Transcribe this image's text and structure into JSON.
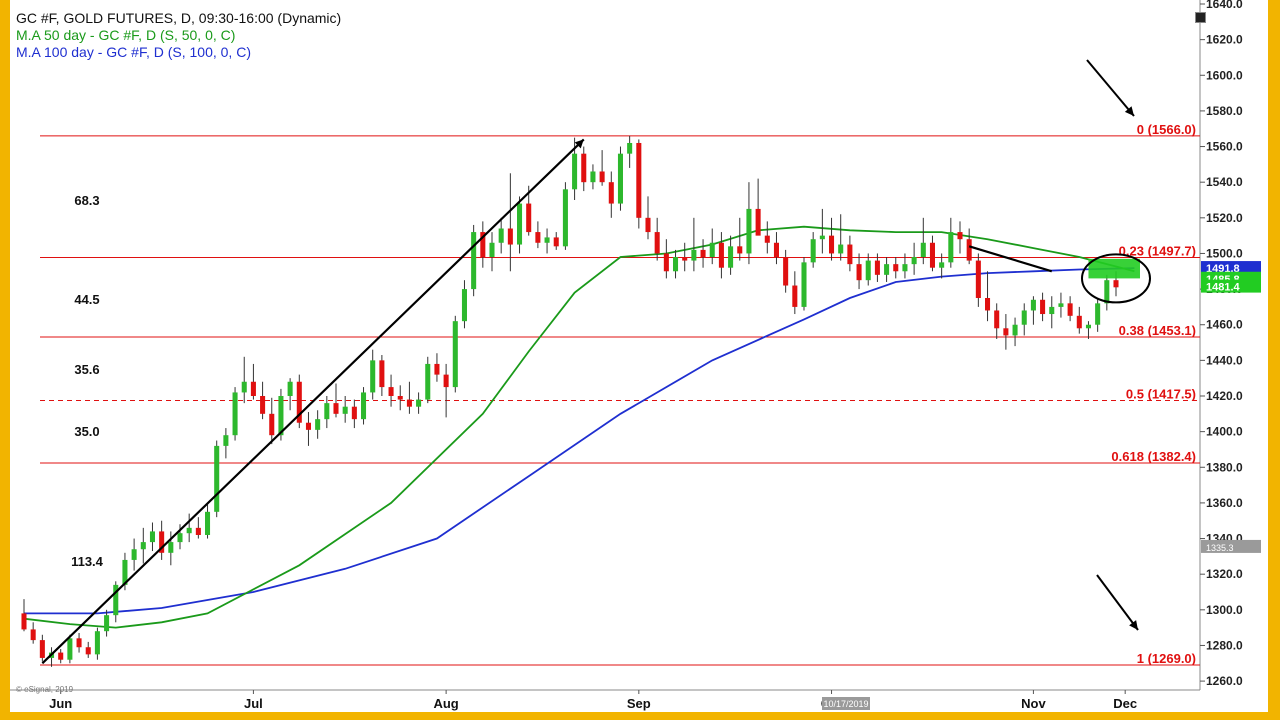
{
  "legend": {
    "title": "GC #F, GOLD FUTURES, D, 09:30-16:00 (Dynamic)",
    "ma50": "M.A 50 day - GC #F, D (S, 50, 0, C)",
    "ma100": "M.A 100 day - GC #F, D (S, 100, 0, C)"
  },
  "colors": {
    "up": "#2db82d",
    "down": "#e01010",
    "ma50": "#1a9a1a",
    "ma100": "#1f2fd0",
    "fib": "#e01010",
    "frame": "#f2b400",
    "tag_blue": "#1f2fd0",
    "tag_green": "#22cc22"
  },
  "chart_data": {
    "type": "candlestick",
    "title": "GC #F, GOLD FUTURES, D, 09:30-16:00 (Dynamic)",
    "ylim": [
      1255,
      1640
    ],
    "yticks": [
      1260,
      1280,
      1300,
      1320,
      1340,
      1360,
      1380,
      1400,
      1420,
      1440,
      1460,
      1480,
      1500,
      1520,
      1540,
      1560,
      1580,
      1600,
      1620,
      1640
    ],
    "ytick_labels": [
      "1260.0",
      "1280.0",
      "1300.0",
      "1320.0",
      "1340.0",
      "1360.0",
      "1380.0",
      "1400.0",
      "1420.0",
      "1440.0",
      "1460.0",
      "1480.0",
      "1500.0",
      "1520.0",
      "1540.0",
      "1560.0",
      "1580.0",
      "1600.0",
      "1620.0",
      "1640.0"
    ],
    "months": [
      "Jun",
      "Jul",
      "Aug",
      "Sep",
      "Oct",
      "Nov",
      "Dec"
    ],
    "axis_date_label": "10/17/2019",
    "fib_levels": [
      {
        "label": "0 (1566.0)",
        "value": 1566.0,
        "dashed": false
      },
      {
        "label": "0.23 (1497.7)",
        "value": 1497.7,
        "dashed": false
      },
      {
        "label": "0.38 (1453.1)",
        "value": 1453.1,
        "dashed": false
      },
      {
        "label": "0.5 (1417.5)",
        "value": 1417.5,
        "dashed": true
      },
      {
        "label": "0.618 (1382.4)",
        "value": 1382.4,
        "dashed": false
      },
      {
        "label": "1 (1269.0)",
        "value": 1269.0,
        "dashed": false
      }
    ],
    "annotations": [
      "68.3",
      "44.5",
      "35.6",
      "35.0",
      "113.4"
    ],
    "price_tags": [
      {
        "label": "1491.8",
        "value": 1491.8,
        "color": "blue"
      },
      {
        "label": "1485.8",
        "value": 1485.8,
        "color": "green"
      },
      {
        "label": "1481.4",
        "value": 1481.4,
        "color": "green"
      },
      {
        "label": "1335.3",
        "value": 1335.3,
        "color": "gray"
      }
    ],
    "ma50": [
      [
        0,
        1295
      ],
      [
        5,
        1292
      ],
      [
        10,
        1290
      ],
      [
        15,
        1293
      ],
      [
        20,
        1298
      ],
      [
        30,
        1325
      ],
      [
        40,
        1360
      ],
      [
        50,
        1410
      ],
      [
        55,
        1445
      ],
      [
        60,
        1478
      ],
      [
        65,
        1498
      ],
      [
        70,
        1500
      ],
      [
        75,
        1505
      ],
      [
        80,
        1513
      ],
      [
        85,
        1515
      ],
      [
        90,
        1513
      ],
      [
        95,
        1512
      ],
      [
        100,
        1512
      ],
      [
        105,
        1508
      ],
      [
        110,
        1503
      ],
      [
        115,
        1498
      ],
      [
        121,
        1490
      ]
    ],
    "ma100": [
      [
        0,
        1298
      ],
      [
        8,
        1298
      ],
      [
        15,
        1301
      ],
      [
        25,
        1310
      ],
      [
        35,
        1323
      ],
      [
        45,
        1340
      ],
      [
        55,
        1375
      ],
      [
        65,
        1410
      ],
      [
        75,
        1440
      ],
      [
        85,
        1463
      ],
      [
        90,
        1475
      ],
      [
        95,
        1484
      ],
      [
        100,
        1487
      ],
      [
        105,
        1489
      ],
      [
        110,
        1490
      ],
      [
        115,
        1491
      ],
      [
        121,
        1491.8
      ]
    ],
    "trendlines": [
      {
        "from": [
          2,
          1270
        ],
        "to": [
          61,
          1564
        ]
      },
      {
        "from": [
          103,
          1504
        ],
        "to": [
          112,
          1490
        ]
      }
    ],
    "candles": [
      {
        "o": 1298,
        "h": 1306,
        "l": 1288,
        "c": 1289
      },
      {
        "o": 1289,
        "h": 1293,
        "l": 1281,
        "c": 1283
      },
      {
        "o": 1283,
        "h": 1286,
        "l": 1271,
        "c": 1273
      },
      {
        "o": 1273,
        "h": 1279,
        "l": 1268,
        "c": 1276
      },
      {
        "o": 1276,
        "h": 1278,
        "l": 1270,
        "c": 1272
      },
      {
        "o": 1272,
        "h": 1286,
        "l": 1270,
        "c": 1284
      },
      {
        "o": 1284,
        "h": 1287,
        "l": 1276,
        "c": 1279
      },
      {
        "o": 1279,
        "h": 1282,
        "l": 1273,
        "c": 1275
      },
      {
        "o": 1275,
        "h": 1290,
        "l": 1272,
        "c": 1288
      },
      {
        "o": 1288,
        "h": 1300,
        "l": 1285,
        "c": 1297
      },
      {
        "o": 1297,
        "h": 1316,
        "l": 1293,
        "c": 1314
      },
      {
        "o": 1314,
        "h": 1332,
        "l": 1311,
        "c": 1328
      },
      {
        "o": 1328,
        "h": 1340,
        "l": 1322,
        "c": 1334
      },
      {
        "o": 1334,
        "h": 1346,
        "l": 1326,
        "c": 1338
      },
      {
        "o": 1338,
        "h": 1349,
        "l": 1333,
        "c": 1344
      },
      {
        "o": 1344,
        "h": 1350,
        "l": 1328,
        "c": 1332
      },
      {
        "o": 1332,
        "h": 1344,
        "l": 1325,
        "c": 1338
      },
      {
        "o": 1338,
        "h": 1348,
        "l": 1334,
        "c": 1343
      },
      {
        "o": 1343,
        "h": 1354,
        "l": 1338,
        "c": 1346
      },
      {
        "o": 1346,
        "h": 1352,
        "l": 1340,
        "c": 1342
      },
      {
        "o": 1342,
        "h": 1359,
        "l": 1340,
        "c": 1355
      },
      {
        "o": 1355,
        "h": 1395,
        "l": 1352,
        "c": 1392
      },
      {
        "o": 1392,
        "h": 1402,
        "l": 1385,
        "c": 1398
      },
      {
        "o": 1398,
        "h": 1425,
        "l": 1395,
        "c": 1422
      },
      {
        "o": 1422,
        "h": 1442,
        "l": 1416,
        "c": 1428
      },
      {
        "o": 1428,
        "h": 1438,
        "l": 1418,
        "c": 1420
      },
      {
        "o": 1420,
        "h": 1428,
        "l": 1407,
        "c": 1410
      },
      {
        "o": 1410,
        "h": 1419,
        "l": 1393,
        "c": 1398
      },
      {
        "o": 1398,
        "h": 1424,
        "l": 1395,
        "c": 1420
      },
      {
        "o": 1420,
        "h": 1430,
        "l": 1412,
        "c": 1428
      },
      {
        "o": 1428,
        "h": 1432,
        "l": 1402,
        "c": 1405
      },
      {
        "o": 1405,
        "h": 1411,
        "l": 1392,
        "c": 1401
      },
      {
        "o": 1401,
        "h": 1412,
        "l": 1396,
        "c": 1407
      },
      {
        "o": 1407,
        "h": 1420,
        "l": 1402,
        "c": 1416
      },
      {
        "o": 1416,
        "h": 1427,
        "l": 1408,
        "c": 1410
      },
      {
        "o": 1410,
        "h": 1420,
        "l": 1405,
        "c": 1414
      },
      {
        "o": 1414,
        "h": 1418,
        "l": 1402,
        "c": 1407
      },
      {
        "o": 1407,
        "h": 1425,
        "l": 1404,
        "c": 1422
      },
      {
        "o": 1422,
        "h": 1446,
        "l": 1418,
        "c": 1440
      },
      {
        "o": 1440,
        "h": 1443,
        "l": 1420,
        "c": 1425
      },
      {
        "o": 1425,
        "h": 1432,
        "l": 1414,
        "c": 1420
      },
      {
        "o": 1420,
        "h": 1426,
        "l": 1412,
        "c": 1418
      },
      {
        "o": 1418,
        "h": 1428,
        "l": 1410,
        "c": 1414
      },
      {
        "o": 1414,
        "h": 1422,
        "l": 1410,
        "c": 1418
      },
      {
        "o": 1418,
        "h": 1442,
        "l": 1416,
        "c": 1438
      },
      {
        "o": 1438,
        "h": 1444,
        "l": 1428,
        "c": 1432
      },
      {
        "o": 1432,
        "h": 1438,
        "l": 1408,
        "c": 1425
      },
      {
        "o": 1425,
        "h": 1465,
        "l": 1422,
        "c": 1462
      },
      {
        "o": 1462,
        "h": 1485,
        "l": 1458,
        "c": 1480
      },
      {
        "o": 1480,
        "h": 1516,
        "l": 1476,
        "c": 1512
      },
      {
        "o": 1512,
        "h": 1518,
        "l": 1492,
        "c": 1498
      },
      {
        "o": 1498,
        "h": 1512,
        "l": 1490,
        "c": 1506
      },
      {
        "o": 1506,
        "h": 1520,
        "l": 1500,
        "c": 1514
      },
      {
        "o": 1514,
        "h": 1545,
        "l": 1490,
        "c": 1505
      },
      {
        "o": 1505,
        "h": 1532,
        "l": 1500,
        "c": 1528
      },
      {
        "o": 1528,
        "h": 1538,
        "l": 1510,
        "c": 1512
      },
      {
        "o": 1512,
        "h": 1518,
        "l": 1503,
        "c": 1506
      },
      {
        "o": 1506,
        "h": 1514,
        "l": 1500,
        "c": 1509
      },
      {
        "o": 1509,
        "h": 1512,
        "l": 1502,
        "c": 1504
      },
      {
        "o": 1504,
        "h": 1540,
        "l": 1502,
        "c": 1536
      },
      {
        "o": 1536,
        "h": 1565,
        "l": 1530,
        "c": 1556
      },
      {
        "o": 1556,
        "h": 1560,
        "l": 1535,
        "c": 1540
      },
      {
        "o": 1540,
        "h": 1550,
        "l": 1536,
        "c": 1546
      },
      {
        "o": 1546,
        "h": 1558,
        "l": 1538,
        "c": 1540
      },
      {
        "o": 1540,
        "h": 1546,
        "l": 1520,
        "c": 1528
      },
      {
        "o": 1528,
        "h": 1560,
        "l": 1524,
        "c": 1556
      },
      {
        "o": 1556,
        "h": 1566,
        "l": 1548,
        "c": 1562
      },
      {
        "o": 1562,
        "h": 1564,
        "l": 1514,
        "c": 1520
      },
      {
        "o": 1520,
        "h": 1532,
        "l": 1508,
        "c": 1512
      },
      {
        "o": 1512,
        "h": 1520,
        "l": 1496,
        "c": 1500
      },
      {
        "o": 1500,
        "h": 1508,
        "l": 1486,
        "c": 1490
      },
      {
        "o": 1490,
        "h": 1502,
        "l": 1486,
        "c": 1498
      },
      {
        "o": 1498,
        "h": 1506,
        "l": 1490,
        "c": 1496
      },
      {
        "o": 1496,
        "h": 1520,
        "l": 1490,
        "c": 1502
      },
      {
        "o": 1502,
        "h": 1508,
        "l": 1492,
        "c": 1498
      },
      {
        "o": 1498,
        "h": 1514,
        "l": 1494,
        "c": 1506
      },
      {
        "o": 1506,
        "h": 1512,
        "l": 1486,
        "c": 1492
      },
      {
        "o": 1492,
        "h": 1510,
        "l": 1488,
        "c": 1504
      },
      {
        "o": 1504,
        "h": 1520,
        "l": 1496,
        "c": 1500
      },
      {
        "o": 1500,
        "h": 1540,
        "l": 1494,
        "c": 1525
      },
      {
        "o": 1525,
        "h": 1542,
        "l": 1515,
        "c": 1510
      },
      {
        "o": 1510,
        "h": 1518,
        "l": 1500,
        "c": 1506
      },
      {
        "o": 1506,
        "h": 1512,
        "l": 1494,
        "c": 1498
      },
      {
        "o": 1498,
        "h": 1502,
        "l": 1478,
        "c": 1482
      },
      {
        "o": 1482,
        "h": 1490,
        "l": 1466,
        "c": 1470
      },
      {
        "o": 1470,
        "h": 1498,
        "l": 1468,
        "c": 1495
      },
      {
        "o": 1495,
        "h": 1512,
        "l": 1492,
        "c": 1508
      },
      {
        "o": 1508,
        "h": 1525,
        "l": 1500,
        "c": 1510
      },
      {
        "o": 1510,
        "h": 1520,
        "l": 1496,
        "c": 1500
      },
      {
        "o": 1500,
        "h": 1522,
        "l": 1496,
        "c": 1505
      },
      {
        "o": 1505,
        "h": 1510,
        "l": 1490,
        "c": 1494
      },
      {
        "o": 1494,
        "h": 1500,
        "l": 1480,
        "c": 1485
      },
      {
        "o": 1485,
        "h": 1500,
        "l": 1482,
        "c": 1496
      },
      {
        "o": 1496,
        "h": 1500,
        "l": 1484,
        "c": 1488
      },
      {
        "o": 1488,
        "h": 1498,
        "l": 1484,
        "c": 1494
      },
      {
        "o": 1494,
        "h": 1498,
        "l": 1486,
        "c": 1490
      },
      {
        "o": 1490,
        "h": 1500,
        "l": 1486,
        "c": 1494
      },
      {
        "o": 1494,
        "h": 1506,
        "l": 1488,
        "c": 1498
      },
      {
        "o": 1498,
        "h": 1520,
        "l": 1494,
        "c": 1506
      },
      {
        "o": 1506,
        "h": 1510,
        "l": 1490,
        "c": 1492
      },
      {
        "o": 1492,
        "h": 1500,
        "l": 1486,
        "c": 1495
      },
      {
        "o": 1495,
        "h": 1520,
        "l": 1492,
        "c": 1512
      },
      {
        "o": 1512,
        "h": 1518,
        "l": 1500,
        "c": 1508
      },
      {
        "o": 1508,
        "h": 1514,
        "l": 1494,
        "c": 1496
      },
      {
        "o": 1496,
        "h": 1500,
        "l": 1470,
        "c": 1475
      },
      {
        "o": 1475,
        "h": 1490,
        "l": 1462,
        "c": 1468
      },
      {
        "o": 1468,
        "h": 1472,
        "l": 1452,
        "c": 1458
      },
      {
        "o": 1458,
        "h": 1466,
        "l": 1446,
        "c": 1454
      },
      {
        "o": 1454,
        "h": 1464,
        "l": 1448,
        "c": 1460
      },
      {
        "o": 1460,
        "h": 1472,
        "l": 1454,
        "c": 1468
      },
      {
        "o": 1468,
        "h": 1476,
        "l": 1460,
        "c": 1474
      },
      {
        "o": 1474,
        "h": 1478,
        "l": 1462,
        "c": 1466
      },
      {
        "o": 1466,
        "h": 1476,
        "l": 1458,
        "c": 1470
      },
      {
        "o": 1470,
        "h": 1478,
        "l": 1464,
        "c": 1472
      },
      {
        "o": 1472,
        "h": 1476,
        "l": 1462,
        "c": 1465
      },
      {
        "o": 1465,
        "h": 1470,
        "l": 1455,
        "c": 1458
      },
      {
        "o": 1458,
        "h": 1462,
        "l": 1452,
        "c": 1460
      },
      {
        "o": 1460,
        "h": 1475,
        "l": 1456,
        "c": 1472
      },
      {
        "o": 1472,
        "h": 1488,
        "l": 1468,
        "c": 1485
      },
      {
        "o": 1485,
        "h": 1490,
        "l": 1476,
        "c": 1481
      }
    ]
  }
}
